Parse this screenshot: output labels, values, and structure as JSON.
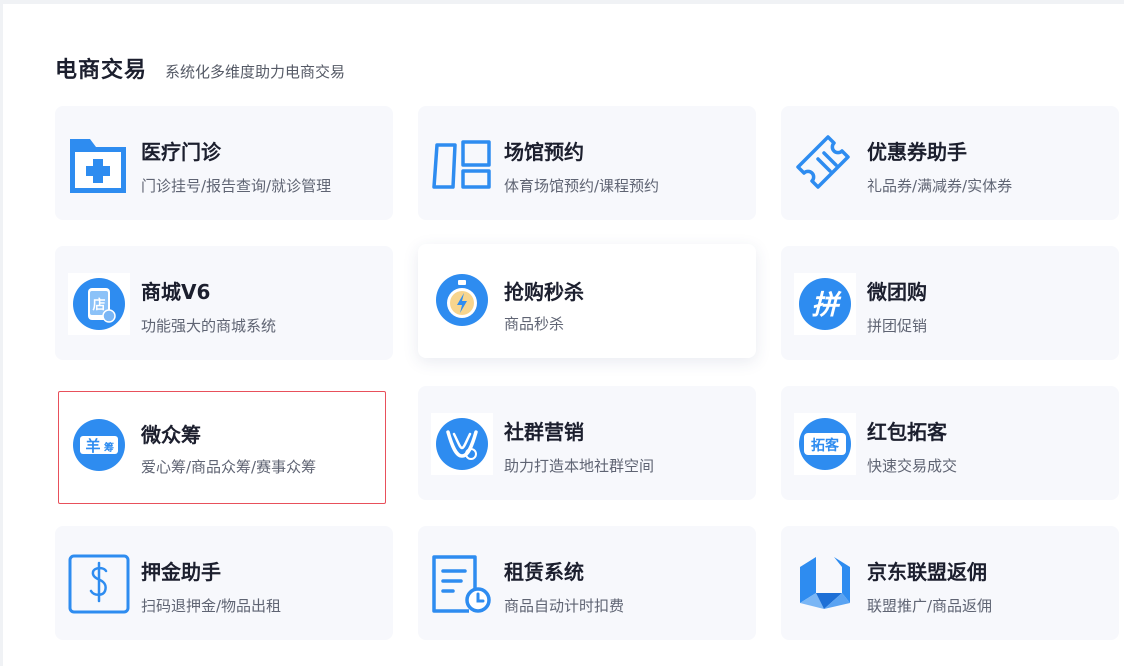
{
  "section": {
    "title": "电商交易",
    "subtitle": "系统化多维度助力电商交易"
  },
  "colors": {
    "accent": "#2e8cf0",
    "selected_border": "#e8505b",
    "card_bg": "#f7f8fc"
  },
  "cards": [
    {
      "name": "医疗门诊",
      "desc": "门诊挂号/报告查询/就诊管理",
      "icon": "medical-folder-icon"
    },
    {
      "name": "场馆预约",
      "desc": "体育场馆预约/课程预约",
      "icon": "venue-layout-icon"
    },
    {
      "name": "优惠券助手",
      "desc": "礼品券/满减券/实体券",
      "icon": "coupon-ticket-icon"
    },
    {
      "name": "商城V6",
      "desc": "功能强大的商城系统",
      "icon": "shop-phone-icon"
    },
    {
      "name": "抢购秒杀",
      "desc": "商品秒杀",
      "icon": "stopwatch-flash-icon"
    },
    {
      "name": "微团购",
      "desc": "拼团促销",
      "icon": "group-buy-pin-icon"
    },
    {
      "name": "微众筹",
      "desc": "爱心筹/商品众筹/赛事众筹",
      "icon": "crowdfunding-yuan-icon",
      "selected": true
    },
    {
      "name": "社群营销",
      "desc": "助力打造本地社群空间",
      "icon": "community-marketing-icon"
    },
    {
      "name": "红包拓客",
      "desc": "快速交易成交",
      "icon": "red-packet-tuoke-icon"
    },
    {
      "name": "押金助手",
      "desc": "扫码退押金/物品出租",
      "icon": "deposit-dollar-icon"
    },
    {
      "name": "租赁系统",
      "desc": "商品自动计时扣费",
      "icon": "lease-document-clock-icon"
    },
    {
      "name": "京东联盟返佣",
      "desc": "联盟推广/商品返佣",
      "icon": "jd-union-logo-icon"
    }
  ],
  "icon_text": {
    "shop": "店",
    "group_buy": "拼",
    "crowdfunding": "羊",
    "crowdfunding_small": "筹",
    "tuoke": "拓客"
  }
}
